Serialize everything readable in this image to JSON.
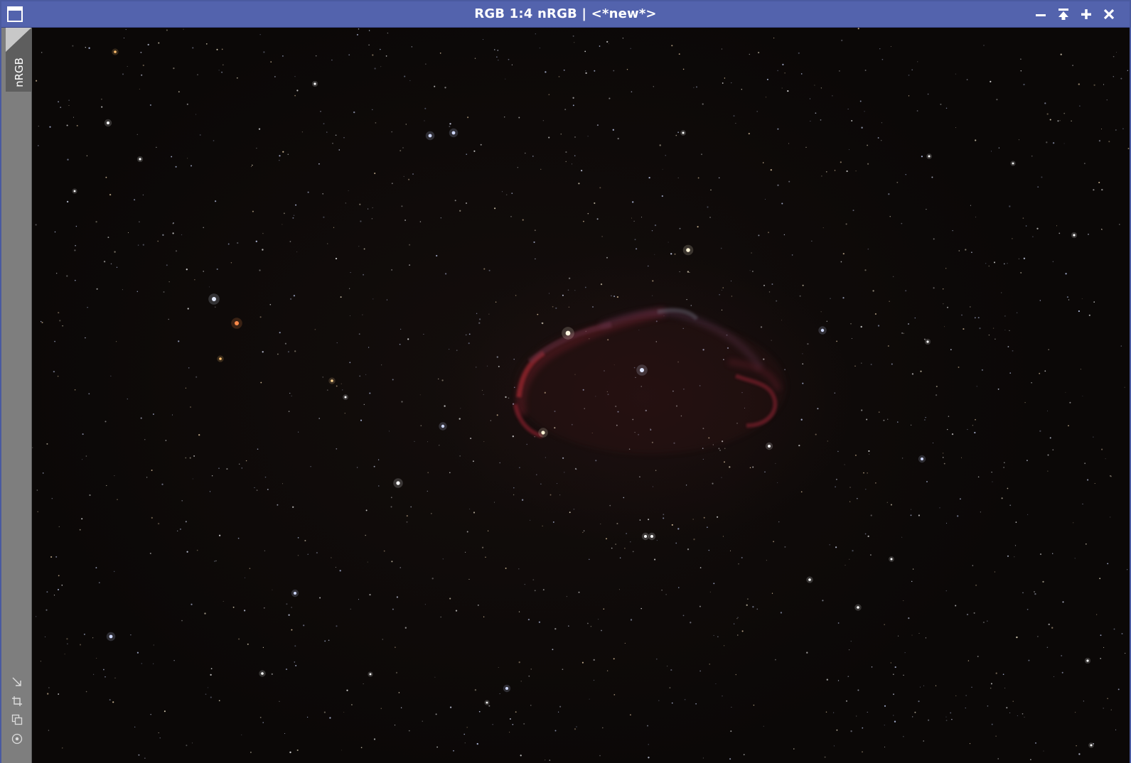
{
  "window": {
    "title": "RGB 1:4 nRGB | <*new*>",
    "menu_icon": "window-menu-icon",
    "buttons": [
      {
        "name": "minimize-button",
        "icon": "minimize-icon"
      },
      {
        "name": "shade-button",
        "icon": "shade-icon"
      },
      {
        "name": "maximize-button",
        "icon": "plus-icon"
      },
      {
        "name": "close-button",
        "icon": "close-icon"
      }
    ],
    "colors": {
      "titlebar": "#5363ad",
      "side_panel": "#7e7e7e",
      "background": "#0b0807"
    }
  },
  "side_panel": {
    "tab_label": "nRGB",
    "tools": [
      {
        "name": "zoom-to-fit-tool",
        "icon": "arrow-diagonal-icon"
      },
      {
        "name": "crop-tool",
        "icon": "crop-icon"
      },
      {
        "name": "clone-view-tool",
        "icon": "copy-icon"
      },
      {
        "name": "target-tool",
        "icon": "target-icon"
      }
    ]
  },
  "image": {
    "subject": "starfield",
    "nebula_color": "#b02a35"
  }
}
